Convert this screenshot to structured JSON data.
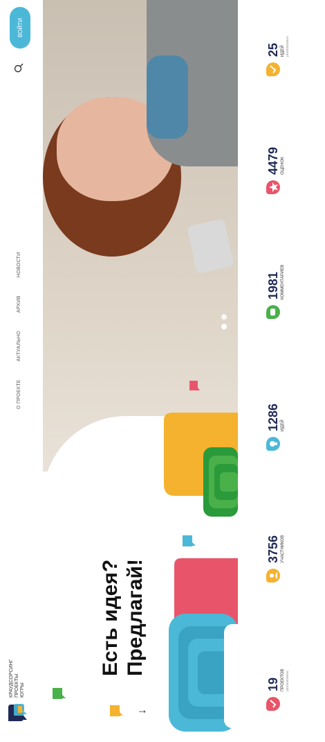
{
  "header": {
    "logo_lines": [
      "КРАУДСОРСИНГ",
      "ПРОЕКТЫ",
      "ЮГРЫ"
    ],
    "nav": [
      "О ПРОЕКТЕ",
      "АКТУАЛЬНО",
      "АРХИВ",
      "НОВОСТИ"
    ],
    "login_label": "ВОЙТИ"
  },
  "hero": {
    "title_line1": "Есть идея?",
    "title_line2": "Предлагай!",
    "arrow": "↓"
  },
  "stats": [
    {
      "number": "19",
      "label": "ПРОЕКТОВ",
      "sub": "реализовано",
      "color": "#e8556a"
    },
    {
      "number": "3756",
      "label": "УЧАСТНИКОВ",
      "sub": "",
      "color": "#f5b22f"
    },
    {
      "number": "1286",
      "label": "ИДЕЙ",
      "sub": "",
      "color": "#4bb8d8"
    },
    {
      "number": "1981",
      "label": "КОММЕНТАРИЕВ",
      "sub": "",
      "color": "#4ab04a"
    },
    {
      "number": "4479",
      "label": "ОЦЕНОК",
      "sub": "",
      "color": "#e8556a"
    },
    {
      "number": "25",
      "label": "ИДЕЙ",
      "sub": "реализовано",
      "color": "#f5b22f"
    }
  ],
  "colors": {
    "accent_blue": "#4bb8d8",
    "accent_orange": "#f5b22f",
    "accent_green": "#4ab04a",
    "accent_red": "#e8556a",
    "navy": "#1f2a55"
  }
}
